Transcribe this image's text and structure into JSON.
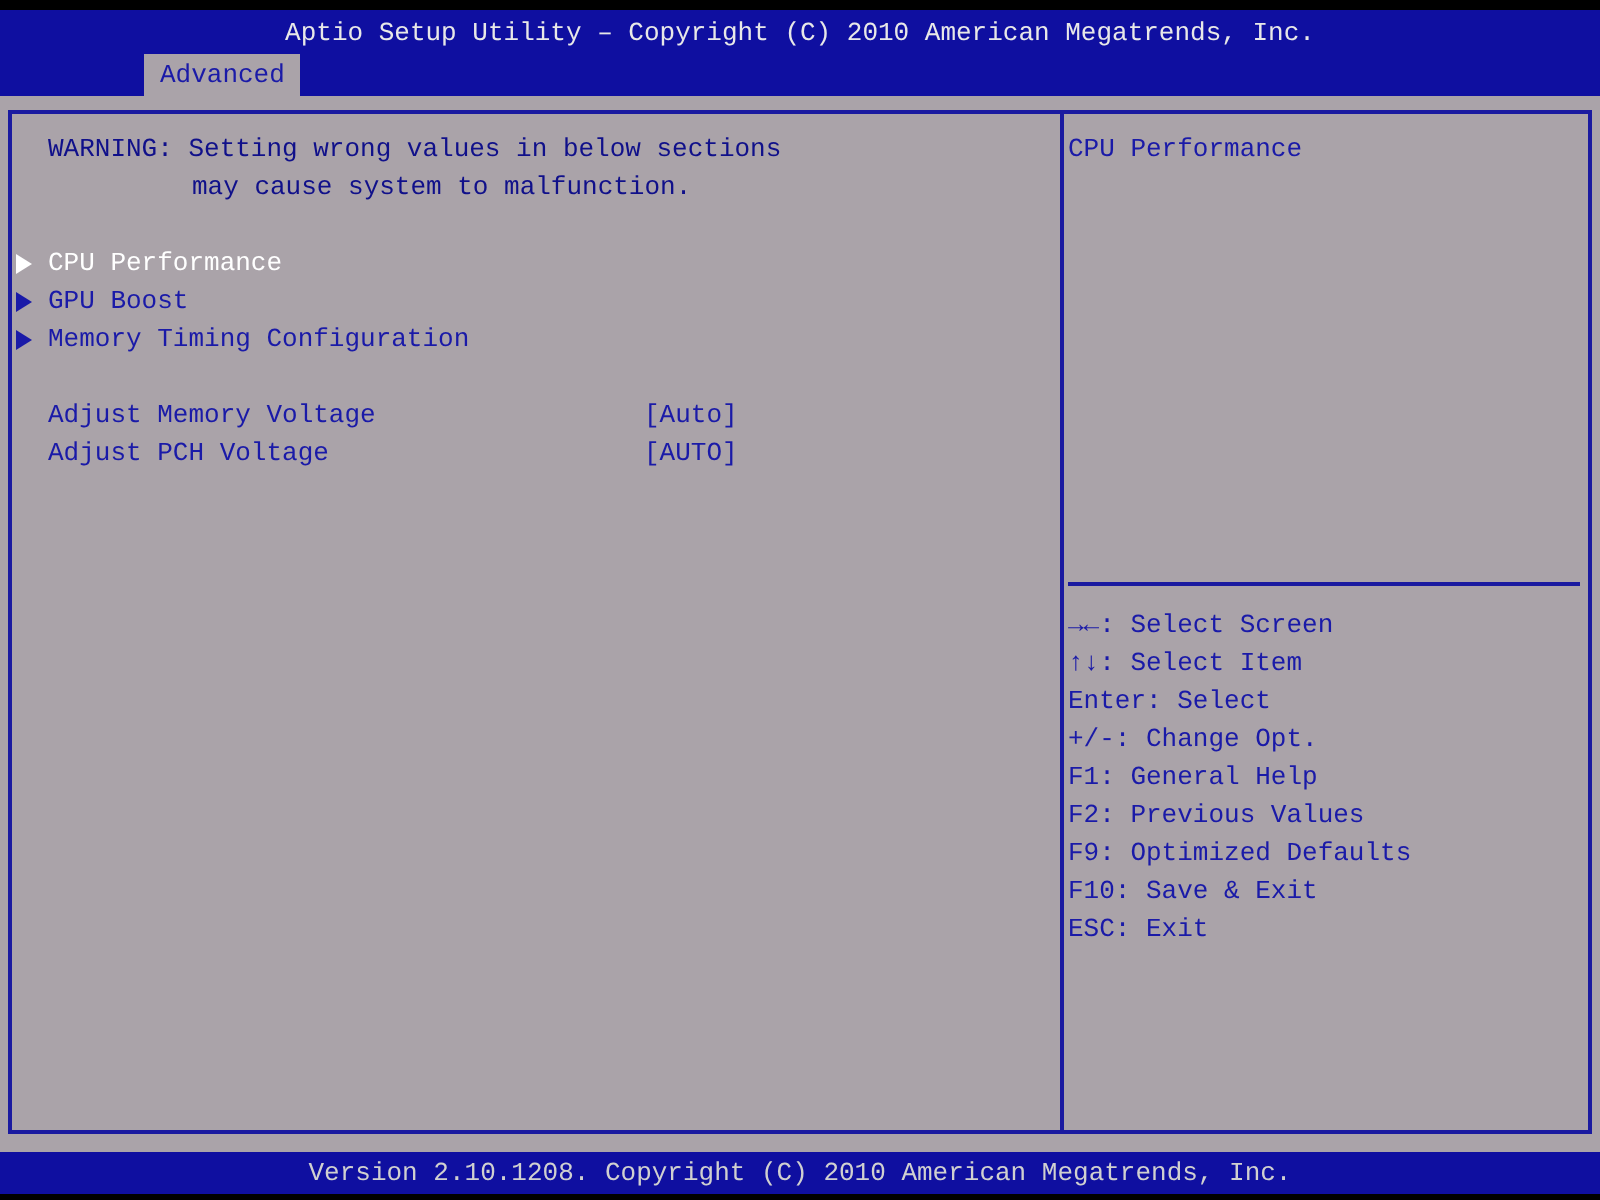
{
  "header": {
    "title": "Aptio Setup Utility – Copyright (C) 2010 American Megatrends, Inc."
  },
  "tabs": [
    {
      "label": "Advanced",
      "selected": true
    }
  ],
  "warning": "WARNING: Setting wrong values in below sections may cause system to malfunction.",
  "items": [
    {
      "kind": "submenu",
      "label": "CPU Performance",
      "selected": true
    },
    {
      "kind": "submenu",
      "label": "GPU Boost",
      "selected": false
    },
    {
      "kind": "submenu",
      "label": "Memory Timing Configuration",
      "selected": false
    },
    {
      "kind": "gap"
    },
    {
      "kind": "setting",
      "label": "Adjust Memory Voltage",
      "value": "[Auto]",
      "selected": false
    },
    {
      "kind": "setting",
      "label": "Adjust PCH Voltage",
      "value": "[AUTO]",
      "selected": false
    }
  ],
  "help": "CPU Performance",
  "keys": [
    "→←: Select Screen",
    "↑↓: Select Item",
    "Enter: Select",
    "+/-: Change Opt.",
    "F1: General Help",
    "F2: Previous Values",
    "F9: Optimized Defaults",
    "F10: Save & Exit",
    "ESC: Exit"
  ],
  "footer": "Version 2.10.1208. Copyright (C) 2010 American Megatrends, Inc."
}
